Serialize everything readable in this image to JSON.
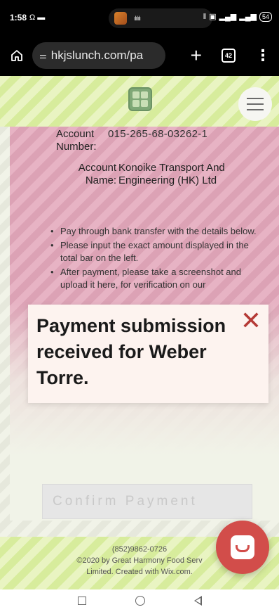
{
  "status_bar": {
    "time": "1:58",
    "battery": "54"
  },
  "browser": {
    "url": "hkjslunch.com/pa",
    "tab_count": "42"
  },
  "account": {
    "number_label": "Account Number:",
    "number_value": "015-265-68-03262-1",
    "name_label": "Account Name:",
    "name_value": "Konoike Transport And Engineering (HK) Ltd"
  },
  "instructions": [
    "Pay through bank transfer with the details below.",
    "Please input the exact amount displayed in the total bar on the left.",
    "After payment, please take a screenshot and upload it here, for verification on our"
  ],
  "toast": {
    "message": "Payment submission received for Weber Torre.",
    "close_glyph": "✕"
  },
  "confirm_button": {
    "label": "Confirm Payment"
  },
  "footer": {
    "phone": "(852)9862-0726",
    "copyright": "©2020 by Great Harmony Food Serv",
    "credit": "Limited. Created with Wix.com."
  },
  "colors": {
    "header_green": "#d7ec9c",
    "content_pink": "#e7b3c4",
    "toast_bg": "#fdf3ef",
    "close_red": "#b53a36",
    "chat_red": "#d24d4a"
  }
}
